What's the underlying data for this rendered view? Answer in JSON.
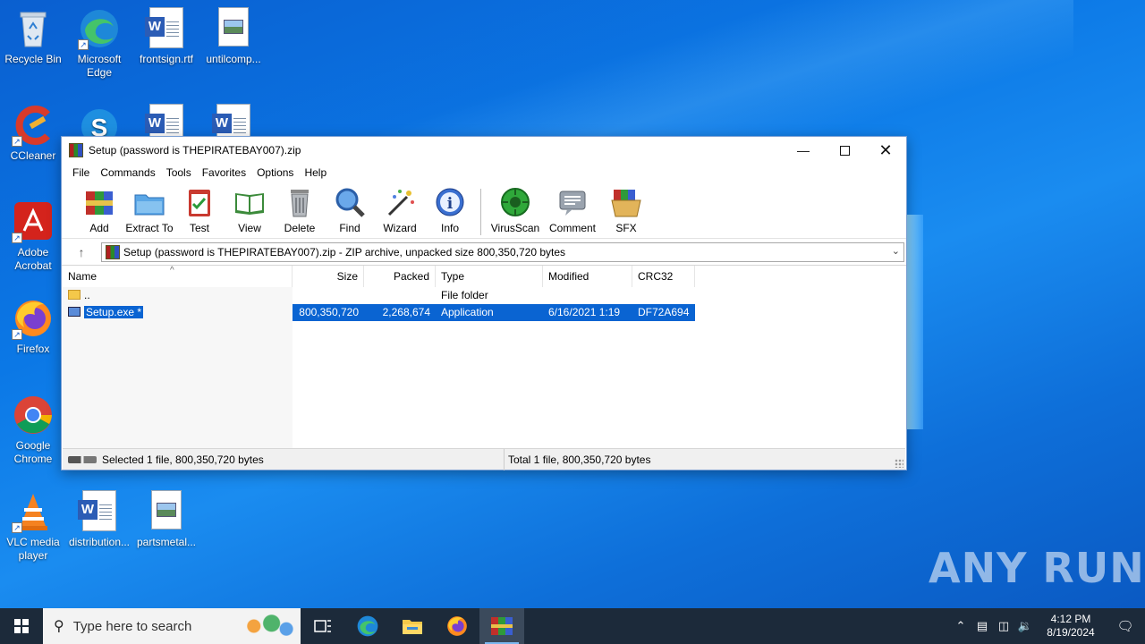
{
  "desktop": {
    "icons": [
      {
        "label": "Recycle Bin"
      },
      {
        "label": "Microsoft Edge"
      },
      {
        "label": "frontsign.rtf"
      },
      {
        "label": "untilcomp..."
      },
      {
        "label": "CCleaner"
      },
      {
        "label": "Adobe Acrobat"
      },
      {
        "label": "Firefox"
      },
      {
        "label": "Google Chrome"
      },
      {
        "label": "VLC media player"
      },
      {
        "label": "distribution..."
      },
      {
        "label": "partsmetal..."
      }
    ],
    "watermark": "ANY RUN"
  },
  "window": {
    "title": "Setup (password is THEPIRATEBAY007).zip",
    "menu": [
      "File",
      "Commands",
      "Tools",
      "Favorites",
      "Options",
      "Help"
    ],
    "toolbar": [
      "Add",
      "Extract To",
      "Test",
      "View",
      "Delete",
      "Find",
      "Wizard",
      "Info",
      "VirusScan",
      "Comment",
      "SFX"
    ],
    "address": "Setup (password is THEPIRATEBAY007).zip - ZIP archive, unpacked size 800,350,720 bytes",
    "columns": [
      "Name",
      "Size",
      "Packed",
      "Type",
      "Modified",
      "CRC32"
    ],
    "rows": [
      {
        "name": "..",
        "size": "",
        "packed": "",
        "type": "File folder",
        "modified": "",
        "crc": ""
      },
      {
        "name": "Setup.exe *",
        "size": "800,350,720",
        "packed": "2,268,674",
        "type": "Application",
        "modified": "6/16/2021 1:19 ...",
        "crc": "DF72A694"
      }
    ],
    "status_left": "Selected 1 file, 800,350,720 bytes",
    "status_right": "Total 1 file, 800,350,720 bytes"
  },
  "taskbar": {
    "search_placeholder": "Type here to search",
    "time": "4:12 PM",
    "date": "8/19/2024"
  }
}
